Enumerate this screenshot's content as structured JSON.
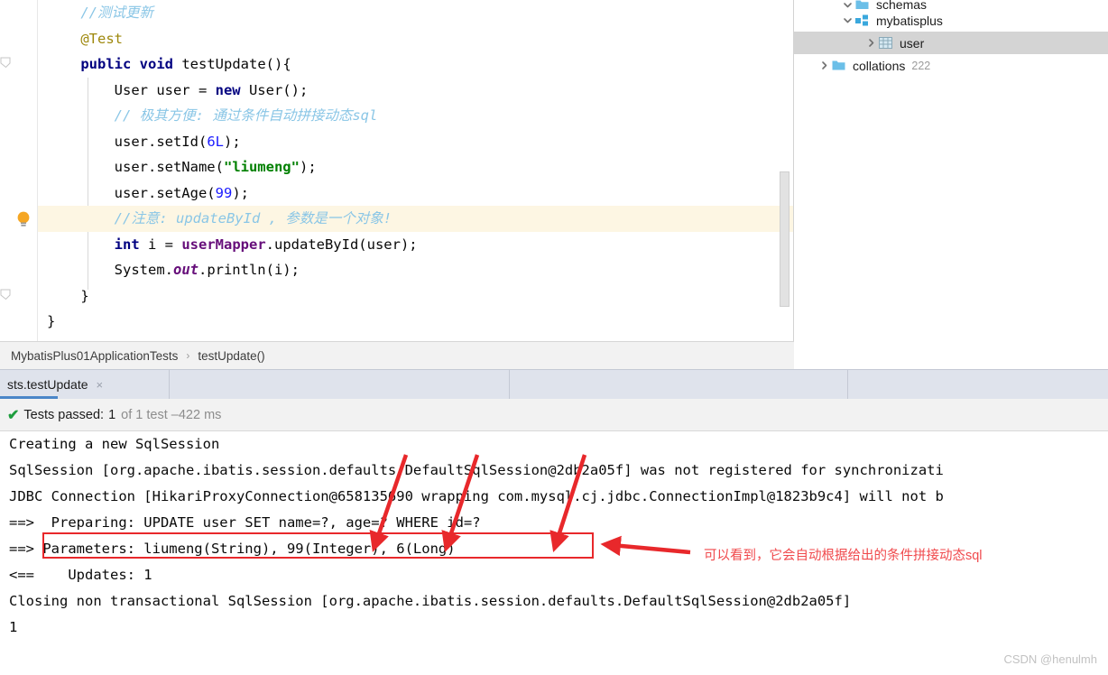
{
  "editor": {
    "lines": [
      {
        "id": "l1",
        "indent": 4,
        "highlight": false,
        "tokens": [
          {
            "t": "//测试更新",
            "c": "cm"
          }
        ]
      },
      {
        "id": "l2",
        "indent": 4,
        "highlight": false,
        "tokens": [
          {
            "t": "@Test",
            "c": "an"
          }
        ]
      },
      {
        "id": "l3",
        "indent": 4,
        "highlight": false,
        "tokens": [
          {
            "t": "public",
            "c": "k"
          },
          {
            "t": " ",
            "c": "pl"
          },
          {
            "t": "void",
            "c": "k"
          },
          {
            "t": " testUpdate(){",
            "c": "pl"
          }
        ]
      },
      {
        "id": "l4",
        "indent": 8,
        "highlight": false,
        "tokens": [
          {
            "t": "User user = ",
            "c": "pl"
          },
          {
            "t": "new",
            "c": "k"
          },
          {
            "t": " User();",
            "c": "pl"
          }
        ]
      },
      {
        "id": "l5",
        "indent": 8,
        "highlight": false,
        "tokens": [
          {
            "t": "// 极其方便: 通过条件自动拼接动态sql",
            "c": "cm"
          }
        ]
      },
      {
        "id": "l6",
        "indent": 8,
        "highlight": false,
        "tokens": [
          {
            "t": "user.setId(",
            "c": "pl"
          },
          {
            "t": "6L",
            "c": "nu"
          },
          {
            "t": ");",
            "c": "pl"
          }
        ]
      },
      {
        "id": "l7",
        "indent": 8,
        "highlight": false,
        "tokens": [
          {
            "t": "user.setName(",
            "c": "pl"
          },
          {
            "t": "\"liumeng\"",
            "c": "st"
          },
          {
            "t": ");",
            "c": "pl"
          }
        ]
      },
      {
        "id": "l8",
        "indent": 8,
        "highlight": false,
        "tokens": [
          {
            "t": "user.setAge(",
            "c": "pl"
          },
          {
            "t": "99",
            "c": "nu"
          },
          {
            "t": ");",
            "c": "pl"
          }
        ]
      },
      {
        "id": "l9",
        "indent": 8,
        "highlight": true,
        "tokens": [
          {
            "t": "//注意: updateById , 参数是一个对象!",
            "c": "cm"
          }
        ]
      },
      {
        "id": "l10",
        "indent": 8,
        "highlight": false,
        "tokens": [
          {
            "t": "int",
            "c": "k"
          },
          {
            "t": " i = ",
            "c": "pl"
          },
          {
            "t": "userMapper",
            "c": "fd"
          },
          {
            "t": ".updateById(user);",
            "c": "pl"
          }
        ]
      },
      {
        "id": "l11",
        "indent": 8,
        "highlight": false,
        "tokens": [
          {
            "t": "System.",
            "c": "pl"
          },
          {
            "t": "out",
            "c": "fi"
          },
          {
            "t": ".println(i);",
            "c": "pl"
          }
        ]
      },
      {
        "id": "l12",
        "indent": 4,
        "highlight": false,
        "tokens": [
          {
            "t": "}",
            "c": "pl"
          }
        ]
      },
      {
        "id": "l13",
        "indent": 0,
        "highlight": false,
        "tokens": [
          {
            "t": "}",
            "c": "pl"
          }
        ]
      }
    ]
  },
  "breadcrumb": {
    "class_name": "MybatisPlus01ApplicationTests",
    "separator": "›",
    "method_name": "testUpdate()"
  },
  "db_tree": {
    "rows": [
      {
        "label": "schemas",
        "count": "",
        "icon": "folder-icon",
        "arrow": "chevron-down-icon",
        "indent": 52,
        "selected": false,
        "clipped": true
      },
      {
        "label": "mybatisplus",
        "count": "",
        "icon": "schema-icon",
        "arrow": "chevron-down-icon",
        "indent": 52,
        "selected": false,
        "clipped": false
      },
      {
        "label": "user",
        "count": "",
        "icon": "table-icon",
        "arrow": "chevron-right-icon",
        "indent": 78,
        "selected": true,
        "clipped": false
      },
      {
        "label": "collations",
        "count": "222",
        "icon": "folder-icon",
        "arrow": "chevron-right-icon",
        "indent": 26,
        "selected": false,
        "clipped": false
      }
    ]
  },
  "test_tabs": {
    "active_label": "sts.testUpdate",
    "close_glyph": "×",
    "others": [
      "",
      "",
      ""
    ]
  },
  "test_status": {
    "check_glyph": "✔",
    "passed_label": "Tests passed:",
    "passed_count": "1",
    "of_text": "of 1 test – ",
    "duration": "422 ms"
  },
  "console": {
    "lines": [
      "Creating a new SqlSession",
      "SqlSession [org.apache.ibatis.session.defaults.DefaultSqlSession@2db2a05f] was not registered for synchronizati",
      "JDBC Connection [HikariProxyConnection@658135690 wrapping com.mysql.cj.jdbc.ConnectionImpl@1823b9c4] will not b",
      "==>  Preparing: UPDATE user SET name=?, age=? WHERE id=?",
      "==> Parameters: liumeng(String), 99(Integer), 6(Long)",
      "<==    Updates: 1",
      "Closing non transactional SqlSession [org.apache.ibatis.session.defaults.DefaultSqlSession@2db2a05f]",
      "1"
    ]
  },
  "annotations": {
    "note_text": "可以看到，它会自动根据给出的条件拼接动态sql",
    "accent_color": "#e8282b",
    "note_color": "#f0494c"
  },
  "watermark": {
    "text": "CSDN @henulmh"
  }
}
